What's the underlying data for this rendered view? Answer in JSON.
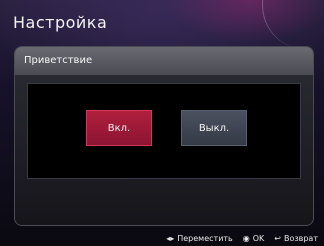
{
  "screen": {
    "title": "Настройка"
  },
  "dialog": {
    "title": "Приветствие",
    "buttons": {
      "on": "Вкл.",
      "off": "Выкл."
    }
  },
  "footer": {
    "move": {
      "icon": "left-right-arrows-icon",
      "glyph": "◂▸",
      "label": "Переместить"
    },
    "ok": {
      "icon": "ok-button-icon",
      "glyph": "◉",
      "label": "OK"
    },
    "back": {
      "icon": "back-arrow-icon",
      "glyph": "↩",
      "label": "Возврат"
    }
  },
  "colors": {
    "accent_on": "#a81a3a",
    "button_off": "#404553"
  }
}
